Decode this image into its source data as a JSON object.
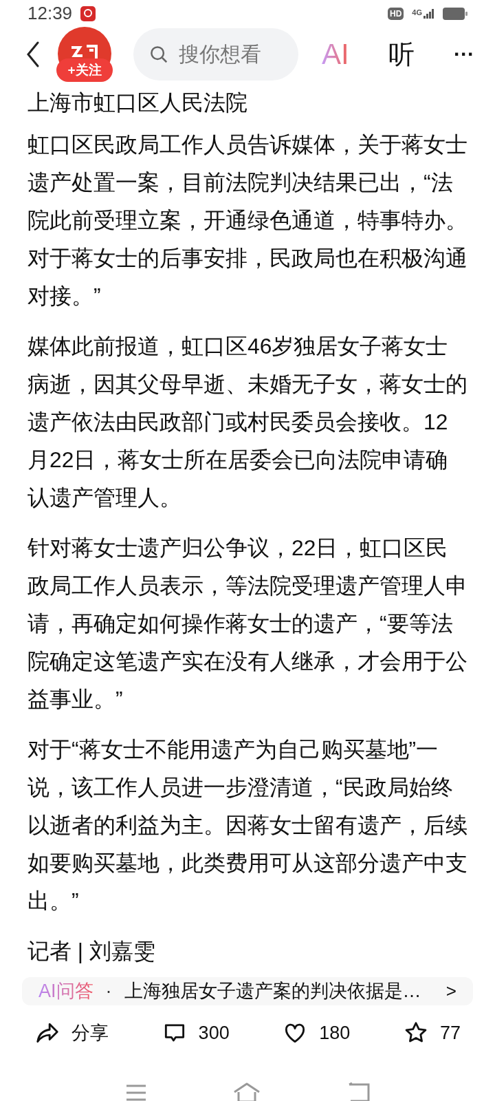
{
  "status_bar": {
    "time": "12:39",
    "hd": "HD",
    "network": "4G"
  },
  "header": {
    "follow": "+关注",
    "search": {
      "placeholder": "搜你想看"
    },
    "ai": "AI",
    "listen": "听",
    "more": "···"
  },
  "article": {
    "source": "上海市虹口区人民法院",
    "paragraphs": [
      "虹口区民政局工作人员告诉媒体，关于蒋女士遗产处置一案，目前法院判决结果已出，“法院此前受理立案，开通绿色通道，特事特办。对于蒋女士的后事安排，民政局也在积极沟通对接。”",
      "媒体此前报道，虹口区46岁独居女子蒋女士病逝，因其父母早逝、未婚无子女，蒋女士的遗产依法由民政部门或村民委员会接收。12月22日，蒋女士所在居委会已向法院申请确认遗产管理人。",
      "针对蒋女士遗产归公争议，22日，虹口区民政局工作人员表示，等法院受理遗产管理人申请，再确定如何操作蒋女士的遗产，“要等法院确定这笔遗产实在没有人继承，才会用于公益事业。”",
      "对于“蒋女士不能用遗产为自己购买墓地”一说，该工作人员进一步澄清道，“民政局始终以逝者的利益为主。因蒋女士留有遗产，后续如要购买墓地，此类费用可从这部分遗产中支出。”"
    ],
    "reporter": "记者 | 刘嘉雯"
  },
  "ai_qa": {
    "label": "AI问答",
    "separator": "·",
    "question": "上海独居女子遗产案的判决依据是…",
    "arrow": ">"
  },
  "actions": [
    {
      "kind": "share",
      "label": "分享"
    },
    {
      "kind": "comment",
      "label": "300"
    },
    {
      "kind": "like",
      "label": "180"
    },
    {
      "kind": "favorite",
      "label": "77"
    }
  ]
}
